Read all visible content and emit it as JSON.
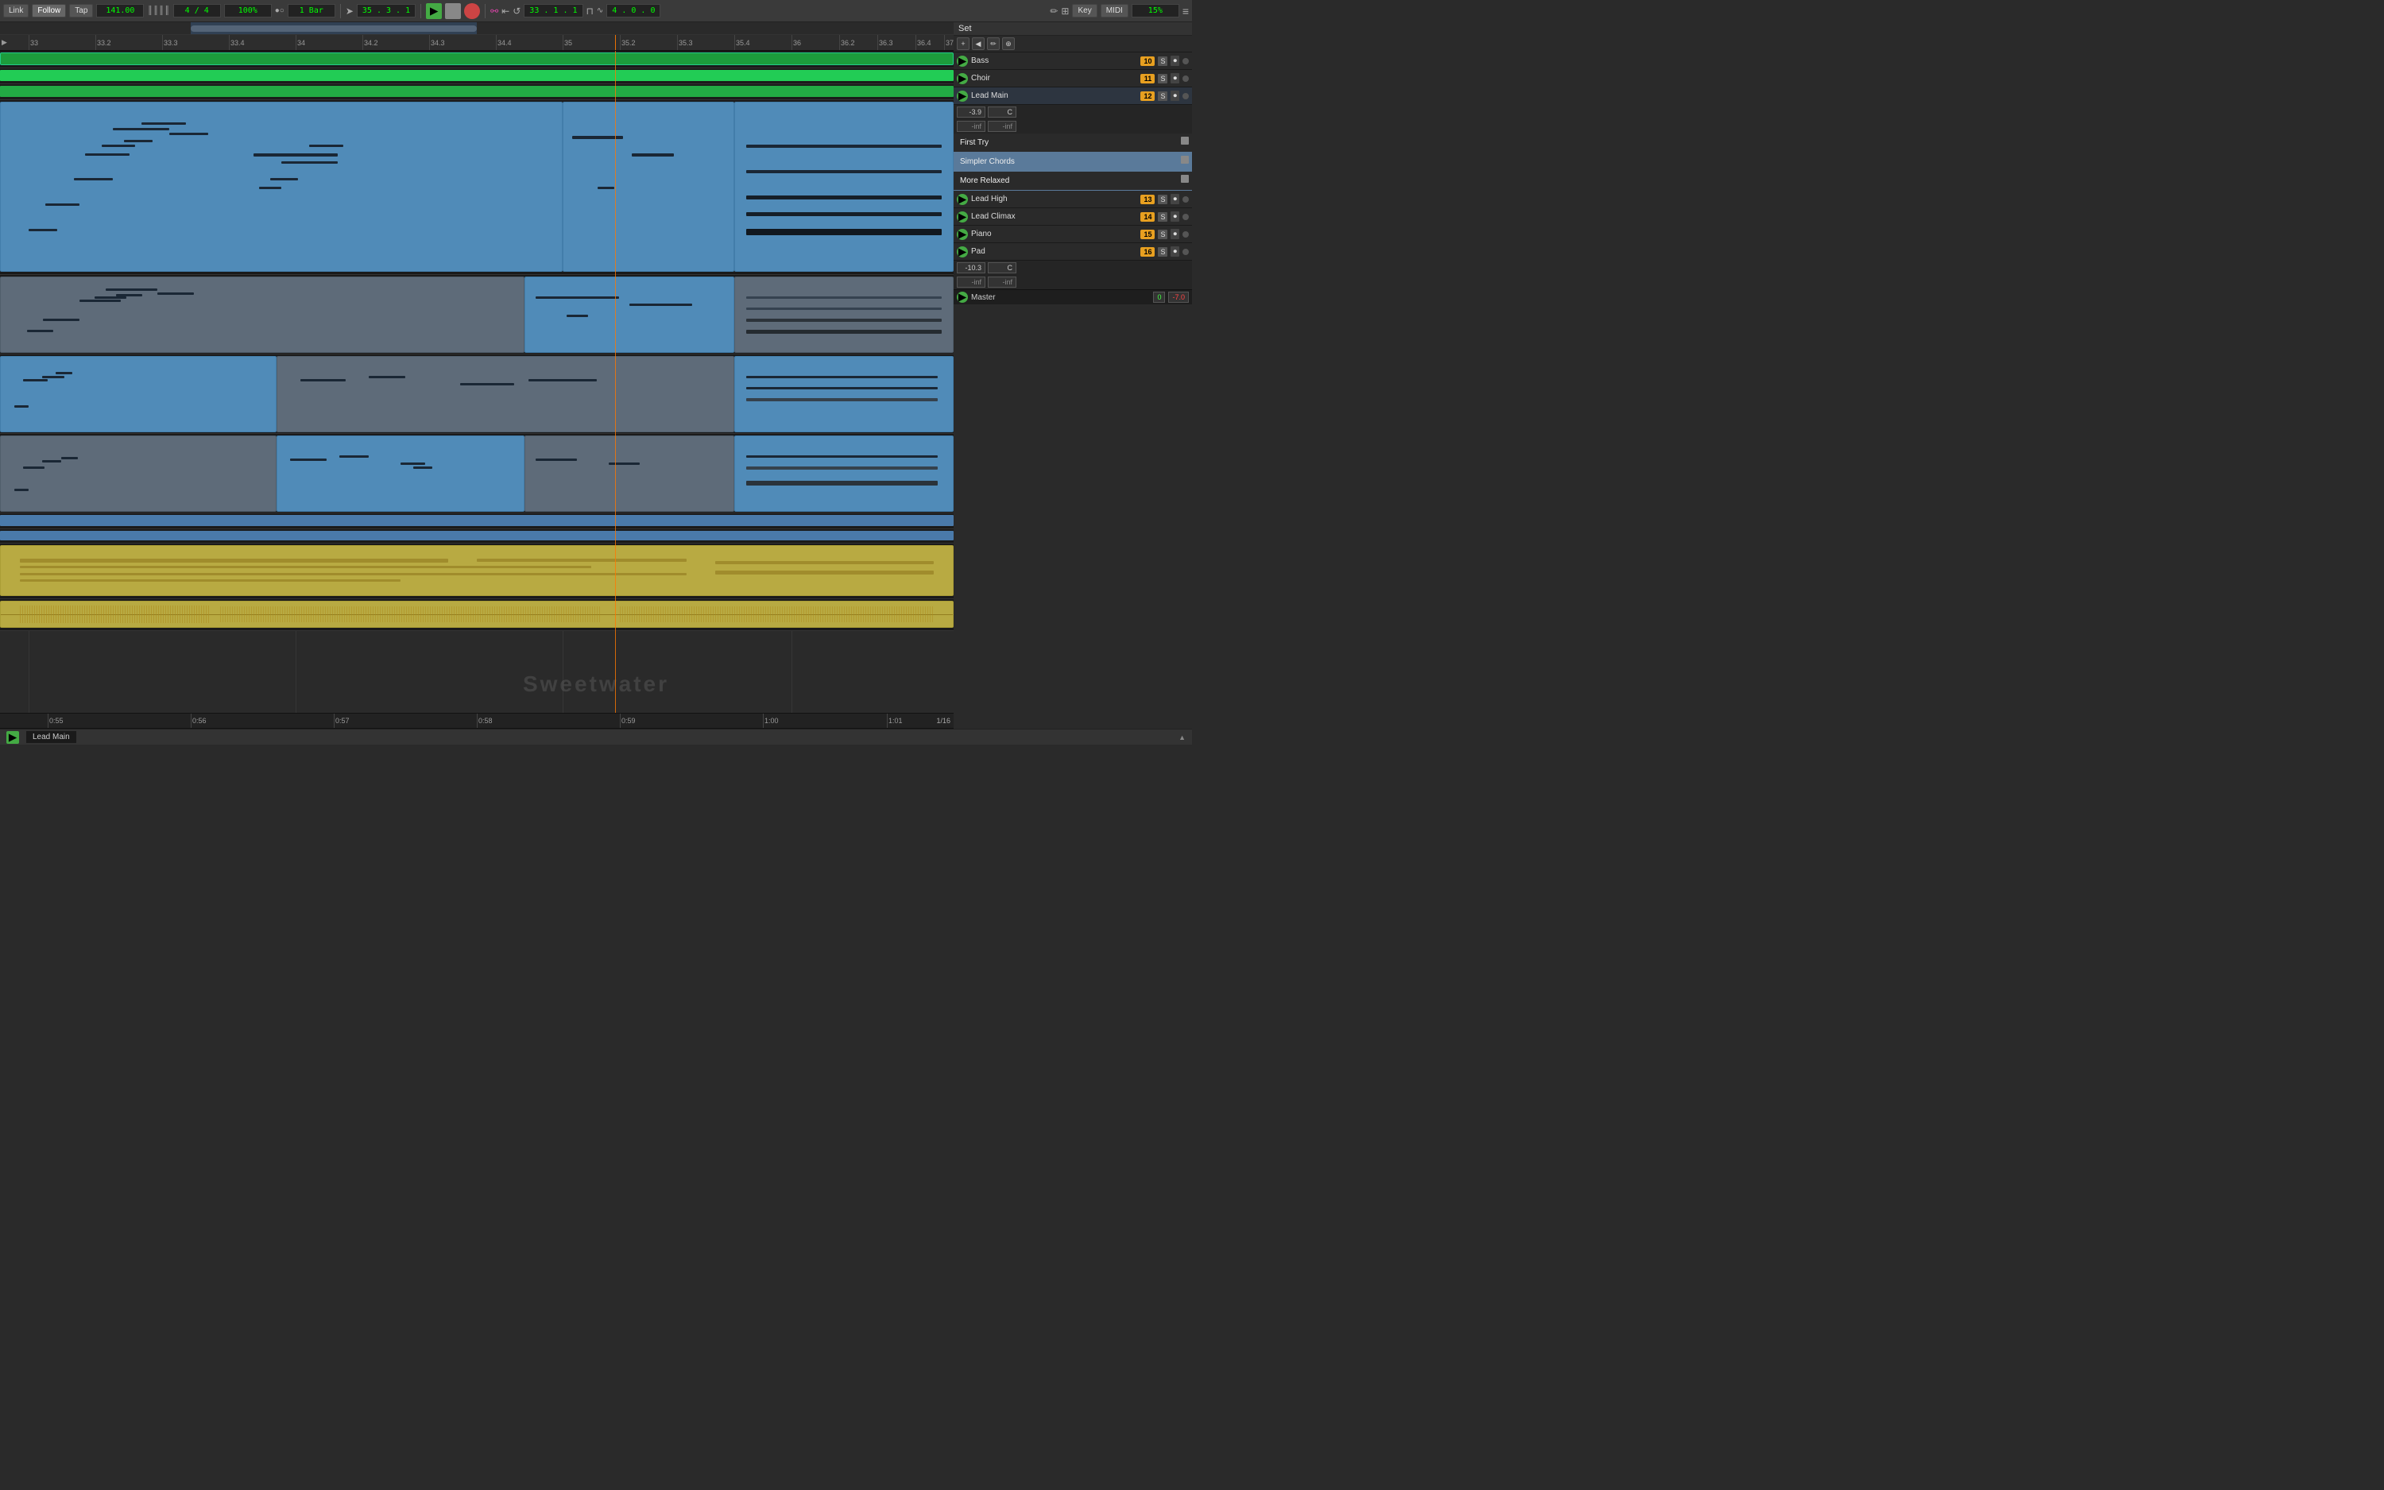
{
  "toolbar": {
    "link_label": "Link",
    "follow_label": "Follow",
    "tap_label": "Tap",
    "bpm": "141.00",
    "time_sig": "4 / 4",
    "zoom": "100%",
    "quantize": "1 Bar",
    "position": "35 . 3 . 1",
    "loop_start": "33 . 1 . 1",
    "loop_length": "4 . 0 . 0",
    "key_label": "Key",
    "midi_label": "MIDI",
    "cpu": "15%"
  },
  "timeline": {
    "marks": [
      "33",
      "33.2",
      "33.3",
      "33.4",
      "34",
      "34.2",
      "34.3",
      "34.4",
      "35",
      "35.2",
      "35.3",
      "35.4",
      "36",
      "36.2",
      "36.3",
      "36.4",
      "37"
    ]
  },
  "set_panel": {
    "title": "Set",
    "tracks": [
      {
        "name": "Bass",
        "num": "10",
        "s": "S",
        "r": "R",
        "active": true
      },
      {
        "name": "Choir",
        "num": "11",
        "s": "S",
        "r": "R",
        "active": true
      },
      {
        "name": "Lead Main",
        "num": "12",
        "s": "S",
        "r": "R",
        "active": true,
        "fader": "-3.9",
        "pan": "C",
        "vol_l": "-inf",
        "vol_r": "-inf"
      },
      {
        "name": "Lead High",
        "num": "13",
        "s": "S",
        "r": "R",
        "active": true
      },
      {
        "name": "Lead Climax",
        "num": "14",
        "s": "S",
        "r": "R",
        "active": true
      },
      {
        "name": "Piano",
        "num": "15",
        "s": "S",
        "r": "R",
        "active": true
      },
      {
        "name": "Pad",
        "num": "16",
        "s": "S",
        "r": "R",
        "active": true,
        "fader": "-10.3",
        "pan": "C",
        "vol_l": "-inf",
        "vol_r": "-inf"
      }
    ],
    "master": {
      "name": "Master",
      "val_l": "0",
      "val_r": "-7.0"
    }
  },
  "alt_clips": [
    {
      "name": "First Try"
    },
    {
      "name": "Simpler Chords"
    },
    {
      "name": "More Relaxed"
    }
  ],
  "bottom_bar": {
    "time_marks": [
      "0:55",
      "0:56",
      "0:57",
      "0:58",
      "0:59",
      "1:00",
      "1:01"
    ],
    "zoom_level": "1/16",
    "clip_name": "Lead Main"
  },
  "watermark": "Sweetwater"
}
